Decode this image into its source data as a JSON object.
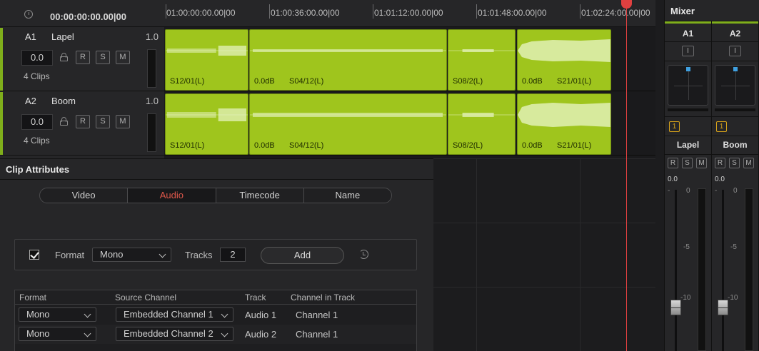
{
  "timeline": {
    "timecode": "00:00:00:00.00|00",
    "ruler_labels": [
      "01:00:00:00.00|00",
      "01:00:36:00.00|00",
      "01:01:12:00.00|00",
      "01:01:48:00.00|00",
      "01:02:24:00.00|00"
    ],
    "tracks": [
      {
        "id": "A1",
        "name": "Lapel",
        "level": "1.0",
        "volume": "0.0",
        "clip_count": "4 Clips",
        "buttons": [
          "R",
          "S",
          "M"
        ],
        "clips": [
          {
            "name": "S12/01(L)",
            "db": ""
          },
          {
            "name": "S04/12(L)",
            "db": "0.0dB"
          },
          {
            "name": "S08/2(L)",
            "db": ""
          },
          {
            "name": "S21/01(L)",
            "db": "0.0dB"
          }
        ]
      },
      {
        "id": "A2",
        "name": "Boom",
        "level": "1.0",
        "volume": "0.0",
        "clip_count": "4 Clips",
        "buttons": [
          "R",
          "S",
          "M"
        ],
        "clips": [
          {
            "name": "S12/01(L)",
            "db": ""
          },
          {
            "name": "S04/12(L)",
            "db": "0.0dB"
          },
          {
            "name": "S08/2(L)",
            "db": ""
          },
          {
            "name": "S21/01(L)",
            "db": "0.0dB"
          }
        ]
      }
    ]
  },
  "clip_attributes": {
    "title": "Clip Attributes",
    "tabs": [
      {
        "label": "Video",
        "active": false
      },
      {
        "label": "Audio",
        "active": true
      },
      {
        "label": "Timecode",
        "active": false
      },
      {
        "label": "Name",
        "active": false
      }
    ],
    "format_label": "Format",
    "format_value": "Mono",
    "format_checked": true,
    "tracks_label": "Tracks",
    "tracks_value": "2",
    "add_label": "Add",
    "table": {
      "headers": [
        "Format",
        "Source Channel",
        "Track",
        "Channel in Track"
      ],
      "rows": [
        {
          "format": "Mono",
          "source": "Embedded Channel 1",
          "track": "Audio 1",
          "channel": "Channel 1"
        },
        {
          "format": "Mono",
          "source": "Embedded Channel 2",
          "track": "Audio 2",
          "channel": "Channel 1"
        }
      ]
    }
  },
  "mixer": {
    "title": "Mixer",
    "strips": [
      {
        "id": "A1",
        "insert": "I",
        "route": "1",
        "name": "Lapel",
        "buttons": [
          "R",
          "S",
          "M"
        ],
        "fader_value": "0.0",
        "scale": [
          "-",
          "0",
          "-5",
          "-10"
        ]
      },
      {
        "id": "A2",
        "insert": "I",
        "route": "1",
        "name": "Boom",
        "buttons": [
          "R",
          "S",
          "M"
        ],
        "fader_value": "0.0",
        "scale": [
          "-",
          "0",
          "-5",
          "-10"
        ]
      }
    ]
  },
  "colors": {
    "clip": "#9fc51d",
    "accent": "#7fae1b",
    "active_tab": "#e0584b",
    "playhead": "#e04040",
    "pan_dot": "#3fa0e0",
    "route": "#d6a21a"
  },
  "icons": [
    "clock-icon",
    "lock-icon",
    "checkbox-check-icon",
    "chevron-down-icon",
    "reset-icon",
    "playhead-marker-icon"
  ]
}
